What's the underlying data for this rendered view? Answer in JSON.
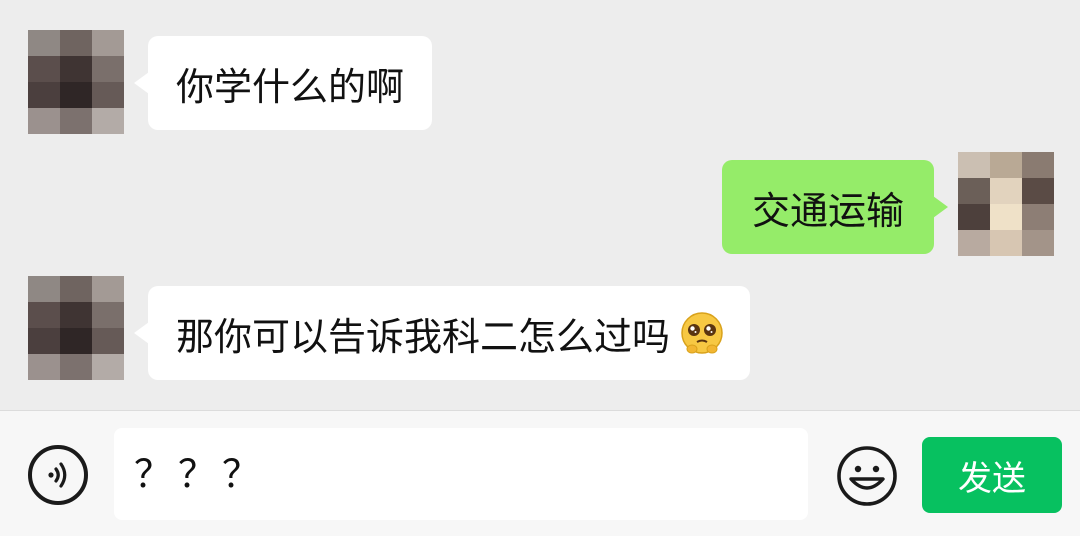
{
  "messages": [
    {
      "side": "left",
      "text": "你学什么的啊",
      "avatar": "blurred-avatar-contact"
    },
    {
      "side": "right",
      "text": "交通运输",
      "avatar": "blurred-avatar-self"
    },
    {
      "side": "left",
      "text": "那你可以告诉我科二怎么过吗",
      "emoji": "pleading-face-emoji",
      "avatar": "blurred-avatar-contact"
    }
  ],
  "input_bar": {
    "value": "？？？",
    "voice_icon": "voice-icon",
    "emoji_icon": "smiley-icon",
    "send_label": "发送"
  },
  "colors": {
    "chat_background": "#ededed",
    "left_bubble": "#ffffff",
    "right_bubble": "#95ec69",
    "send_button": "#07c160"
  }
}
